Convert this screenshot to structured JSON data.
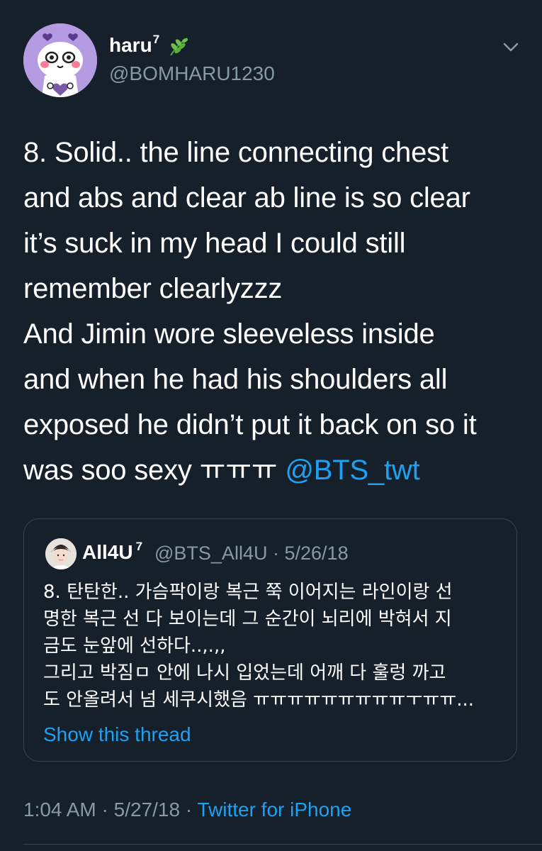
{
  "author": {
    "display_name": "haru",
    "superscript": "7",
    "emoji_icon": "herb-leaf-icon",
    "handle": "@BOMHARU1230",
    "avatar_color": "#b49be2"
  },
  "tweet": {
    "text": "8. Solid.. the line connecting chest\nand abs and clear ab line is so clear\nit’s suck in my head I could still\nremember clearlyzzz\nAnd Jimin wore sleeveless inside\nand when he had his shoulders all\nexposed he didn’t put it back on so it\nwas soo sexy ㅠㅠㅠ ",
    "mention": "@BTS_twt"
  },
  "quoted_tweet": {
    "display_name": "All4U",
    "superscript": "7",
    "handle": "@BTS_All4U",
    "separator": "·",
    "date": "5/26/18",
    "text": "8. 탄탄한.. 가슴팍이랑 복근 쭉 이어지는 라인이랑 선\n명한 복근 선 다 보이는데 그 순간이 뇌리에 박혀서 지\n금도 눈앞에 선하다..,.,,\n그리고 박짐ㅁ 안에 나시 입었는데 어깨 다 훌렁 까고\n도 안올려서 넘 세쿠시했음 ㅠㅠㅠㅠㅠㅠㅠㅠㅠㅜㅠㅠ...",
    "show_thread": "Show this thread"
  },
  "footer": {
    "time": "1:04 AM",
    "separator": "·",
    "date": "5/27/18",
    "source": "Twitter for iPhone"
  },
  "colors": {
    "background": "#15202b",
    "text": "#ffffff",
    "secondary": "#8899a6",
    "link": "#1da1f2",
    "border": "#38444d"
  },
  "icons": {
    "menu": "chevron-down-icon"
  }
}
